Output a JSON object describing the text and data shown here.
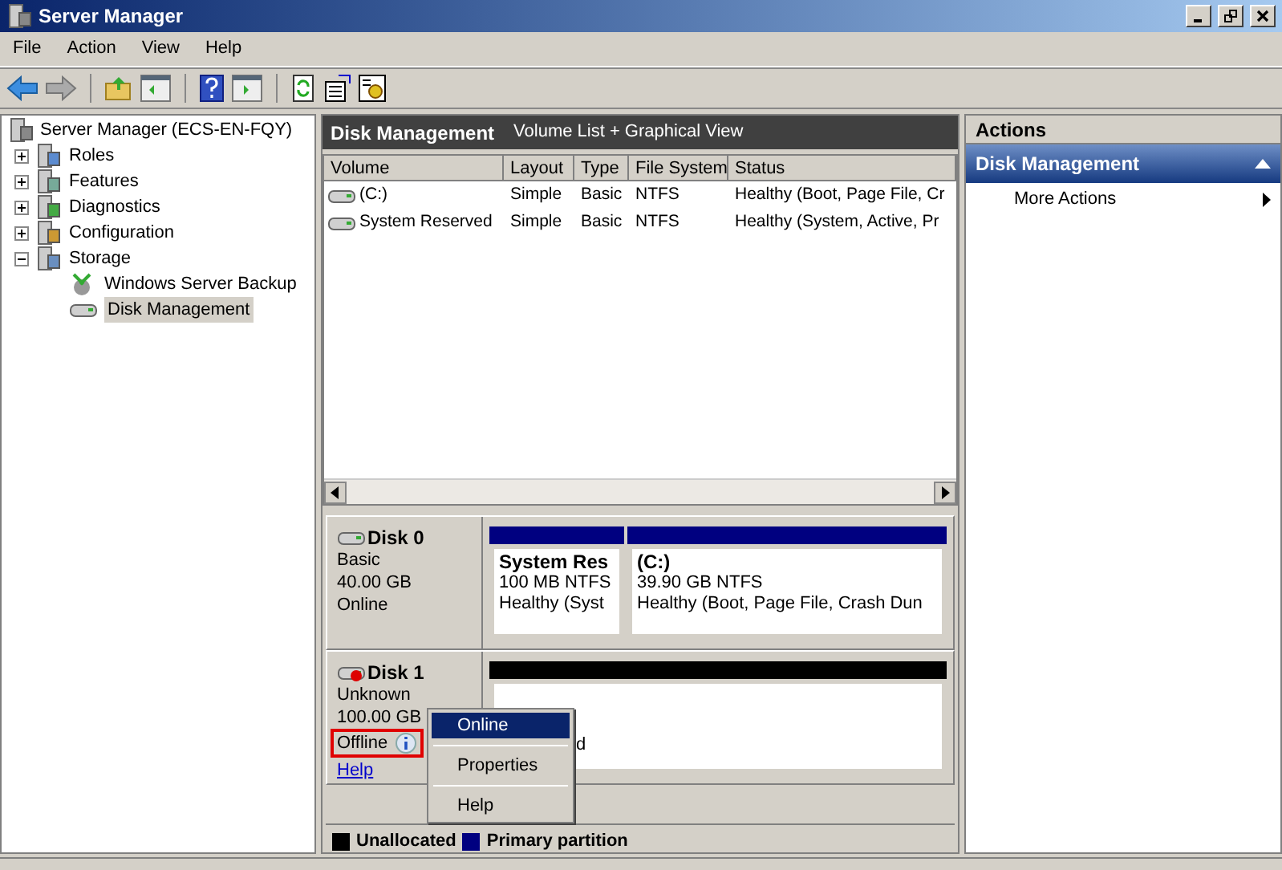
{
  "window": {
    "title": "Server Manager"
  },
  "menu": [
    "File",
    "Action",
    "View",
    "Help"
  ],
  "tree": {
    "label": "Server Manager (ECS-EN-FQY)",
    "children": [
      {
        "label": "Roles",
        "expanded": false,
        "selected": false
      },
      {
        "label": "Features",
        "expanded": false,
        "selected": false
      },
      {
        "label": "Diagnostics",
        "expanded": false,
        "selected": false
      },
      {
        "label": "Configuration",
        "expanded": false,
        "selected": false
      },
      {
        "label": "Storage",
        "expanded": true,
        "selected": false,
        "children": [
          {
            "label": "Windows Server Backup",
            "selected": false
          },
          {
            "label": "Disk Management",
            "selected": true
          }
        ]
      }
    ]
  },
  "center": {
    "title": "Disk Management",
    "subtitle": "Volume List + Graphical View",
    "table": {
      "columns": [
        "Volume",
        "Layout",
        "Type",
        "File System",
        "Status"
      ],
      "rows": [
        [
          "(C:)",
          "Simple",
          "Basic",
          "NTFS",
          "Healthy (Boot, Page File, Cr"
        ],
        [
          "System Reserved",
          "Simple",
          "Basic",
          "NTFS",
          "Healthy (System, Active, Pr"
        ]
      ]
    },
    "disks": [
      {
        "name": "Disk 0",
        "kind": "online",
        "lines": [
          "Basic",
          "40.00 GB",
          "Online"
        ],
        "partitions": [
          {
            "name": "System Res",
            "size": "100 MB NTFS",
            "status": "Healthy (Syst",
            "color": "#000080"
          },
          {
            "name": "(C:)",
            "size": "39.90 GB NTFS",
            "status": "Healthy (Boot, Page File, Crash Dun",
            "color": "#000080"
          }
        ]
      },
      {
        "name": "Disk 1",
        "kind": "offline",
        "lines": [
          "Unknown",
          "100.00 GB"
        ],
        "state": "Offline",
        "help": "Help",
        "partitions": [
          {
            "status": "d",
            "color": "#000000"
          }
        ]
      }
    ],
    "legend": [
      {
        "label": "Unallocated",
        "color": "#000000"
      },
      {
        "label": "Primary partition",
        "color": "#000080"
      }
    ]
  },
  "context_menu": [
    {
      "label": "Online",
      "selected": true
    },
    {
      "label": "Properties",
      "selected": false
    },
    {
      "label": "Help",
      "selected": false
    }
  ],
  "actions": {
    "title": "Actions",
    "section": "Disk Management",
    "items": [
      "More Actions"
    ]
  }
}
